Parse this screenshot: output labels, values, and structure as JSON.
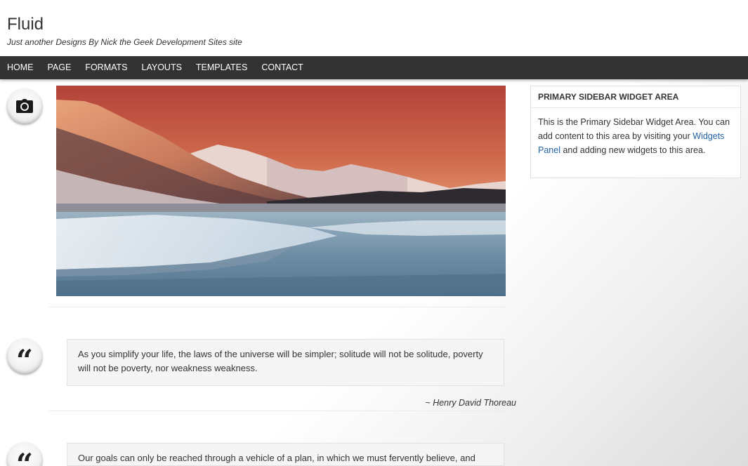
{
  "site": {
    "title": "Fluid",
    "description": "Just another Designs By Nick the Geek Development Sites site"
  },
  "nav": {
    "items": [
      "HOME",
      "PAGE",
      "FORMATS",
      "LAYOUTS",
      "TEMPLATES",
      "CONTACT"
    ]
  },
  "posts": [
    {
      "format_icon": "camera-icon"
    },
    {
      "format_icon": "quote-icon",
      "quote_mark": "“",
      "text": "As you simplify your life, the laws of the universe will be simpler; solitude will not be solitude, poverty will not be poverty, nor weakness weakness.",
      "cite": "~ Henry David Thoreau"
    },
    {
      "format_icon": "quote-icon",
      "quote_mark": "“",
      "text": "Our goals can only be reached through a vehicle of a plan, in which we must fervently believe, and"
    }
  ],
  "sidebar": {
    "widget_title": "PRIMARY SIDEBAR WIDGET AREA",
    "text_before": "This is the Primary Sidebar Widget Area. You can add content to this area by visiting your ",
    "link_text": "Widgets Panel",
    "text_after": " and adding new widgets to this area."
  },
  "colors": {
    "nav_bg": "#333333",
    "link": "#2361a1"
  }
}
